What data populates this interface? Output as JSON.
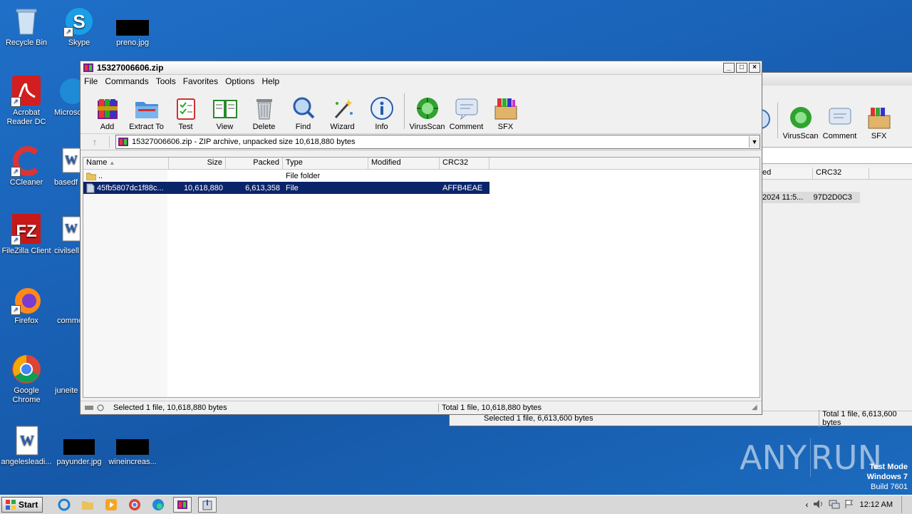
{
  "desktop": {
    "icons": [
      {
        "label": "Recycle Bin"
      },
      {
        "label": "Skype"
      },
      {
        "label": "preno.jpg"
      },
      {
        "label": "Acrobat Reader DC"
      },
      {
        "label": "Microsc"
      },
      {
        "label": "CCleaner"
      },
      {
        "label": "basedf"
      },
      {
        "label": "FileZilla Client"
      },
      {
        "label": "civilsell"
      },
      {
        "label": "Firefox"
      },
      {
        "label": "comme"
      },
      {
        "label": "Google Chrome"
      },
      {
        "label": "juneite"
      },
      {
        "label": "angelesleadi..."
      },
      {
        "label": "payunder.jpg"
      },
      {
        "label": "wineincreas..."
      }
    ],
    "watermark": {
      "brand": "ANY",
      "brand2": "RUN",
      "mode": "Test Mode",
      "os": "Windows 7",
      "build": "Build 7601"
    }
  },
  "back_window": {
    "tools": [
      "VirusScan",
      "Comment",
      "SFX"
    ],
    "col_modified": "ed",
    "col_crc": "CRC32",
    "row_modified": "2024 11:5...",
    "row_crc": "97D2D0C3",
    "status_left": "Selected 1 file, 6,613,600 bytes",
    "status_right": "Total 1 file, 6,613,600 bytes"
  },
  "window": {
    "title": "15327006606.zip",
    "menu": [
      "File",
      "Commands",
      "Tools",
      "Favorites",
      "Options",
      "Help"
    ],
    "tools": [
      "Add",
      "Extract To",
      "Test",
      "View",
      "Delete",
      "Find",
      "Wizard",
      "Info",
      "VirusScan",
      "Comment",
      "SFX"
    ],
    "address": "15327006606.zip - ZIP archive, unpacked size 10,618,880 bytes",
    "columns": [
      "Name",
      "Size",
      "Packed",
      "Type",
      "Modified",
      "CRC32"
    ],
    "rows": [
      {
        "name": "..",
        "size": "",
        "packed": "",
        "type": "File folder",
        "modified": "",
        "crc": ""
      },
      {
        "name": "45fb5807dc1f88c...",
        "size": "10,618,880",
        "packed": "6,613,358",
        "type": "File",
        "modified": "",
        "crc": "AFFB4EAE"
      }
    ],
    "status_left": "Selected 1 file, 10,618,880 bytes",
    "status_right": "Total 1 file, 10,618,880 bytes"
  },
  "taskbar": {
    "start": "Start",
    "time": "12:12 AM"
  }
}
